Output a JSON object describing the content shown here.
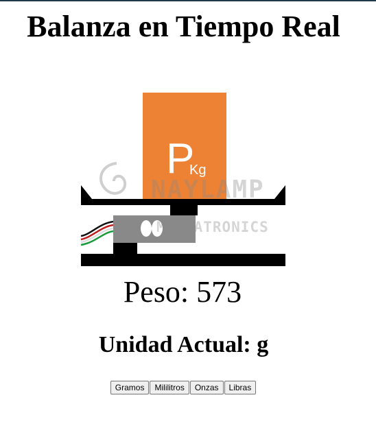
{
  "page": {
    "title": "Balanza en Tiempo Real"
  },
  "illustration": {
    "weight_block_letter": "P",
    "weight_block_unit": "Kg",
    "watermark_line1": "NAYLAMP",
    "watermark_line2": "MECHATRONICS",
    "block_color": "#ee8234"
  },
  "readout": {
    "weight_label": "Peso: 573",
    "unit_label": "Unidad Actual: g"
  },
  "unit_buttons": [
    {
      "label": "Gramos"
    },
    {
      "label": "Mililitros"
    },
    {
      "label": "Onzas"
    },
    {
      "label": "Libras"
    }
  ]
}
